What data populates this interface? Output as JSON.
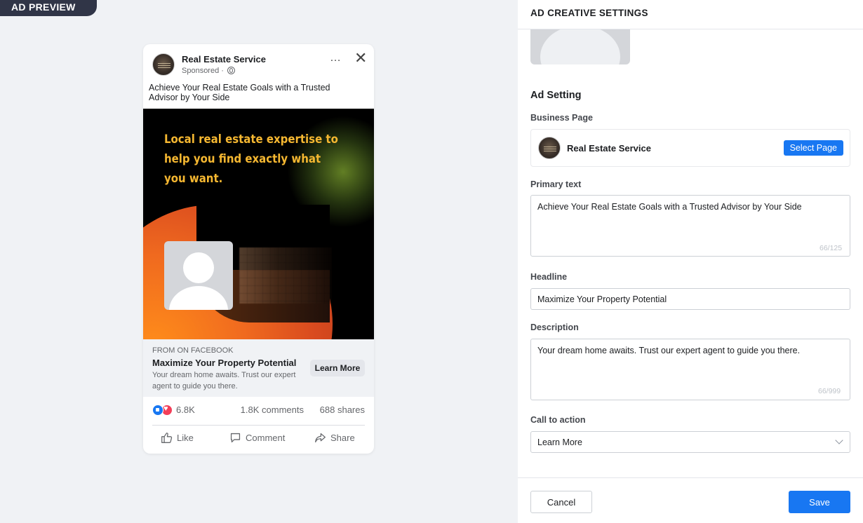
{
  "preview": {
    "tag": "AD PREVIEW",
    "post": {
      "page_name": "Real Estate Service",
      "sponsored": "Sponsored · ",
      "more_icon": "…",
      "close_icon": "✕",
      "primary_text": "Achieve Your Real Estate Goals with a Trusted Advisor by Your Side"
    },
    "creative": {
      "headline": "Local real estate expertise to help you find exactly what you want.",
      "colors": {
        "accent": "#f5b731",
        "orange": "#f06a1f",
        "background": "#000000"
      }
    },
    "cta": {
      "from": "FROM ON FACEBOOK",
      "headline": "Maximize Your Property Potential",
      "description": "Your dream home awaits. Trust our expert agent to guide you there.",
      "button": "Learn More"
    },
    "stats": {
      "reactions": "6.8K",
      "comments": "1.8K comments",
      "shares": "688 shares"
    },
    "actions": {
      "like": "Like",
      "comment": "Comment",
      "share": "Share"
    }
  },
  "settings": {
    "title": "AD CREATIVE SETTINGS",
    "section_title": "Ad Setting",
    "business_page": {
      "label": "Business Page",
      "name": "Real Estate Service",
      "button": "Select Page"
    },
    "primary_text": {
      "label": "Primary text",
      "value": "Achieve Your Real Estate Goals with a Trusted Advisor by Your Side",
      "counter": "66/125"
    },
    "headline": {
      "label": "Headline",
      "value": "Maximize Your Property Potential"
    },
    "description": {
      "label": "Description",
      "value": "Your dream home awaits. Trust our expert agent to guide you there.",
      "counter": "66/999"
    },
    "call_to_action": {
      "label": "Call to action",
      "value": "Learn More"
    },
    "footer": {
      "cancel": "Cancel",
      "save": "Save"
    },
    "colors": {
      "primary": "#1877f2"
    }
  }
}
